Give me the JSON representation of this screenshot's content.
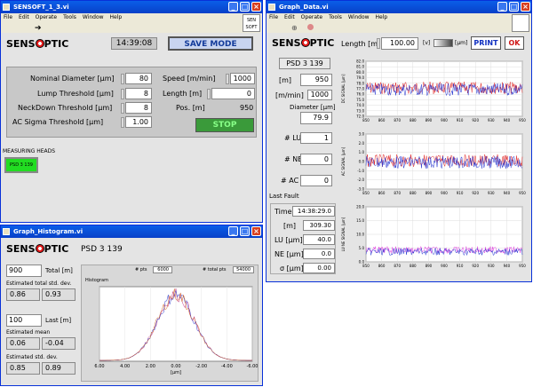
{
  "win1": {
    "title": "SENSOFT_1_3.vi",
    "menu": [
      "File",
      "Edit",
      "Operate",
      "Tools",
      "Window",
      "Help"
    ],
    "logo": "SENSOPTIC",
    "clock": "14:39:08",
    "save_mode": "SAVE MODE",
    "params": [
      {
        "label": "Nominal Diameter [µm]",
        "value": "80"
      },
      {
        "label": "Lump Threshold [µm]",
        "value": "8"
      },
      {
        "label": "NeckDown Threshold [µm]",
        "value": "8"
      },
      {
        "label": "AC Sigma Threshold [µm]",
        "value": "1.00"
      }
    ],
    "speed_label": "Speed [m/min]",
    "speed": "1000",
    "length_label": "Length [m]",
    "length": "0",
    "pos_label": "Pos. [m]",
    "pos": "950",
    "stop": "STOP",
    "heads_label": "MEASURING HEADS",
    "head": "PSD 3 139",
    "corner_icon": "SEN SOFT"
  },
  "win2": {
    "title": "Graph_Data.vi",
    "menu": [
      "File",
      "Edit",
      "Operate",
      "Tools",
      "Window",
      "Help"
    ],
    "logo": "SENSOPTIC",
    "length_label": "Length [m]",
    "length": "100.00",
    "unit_v": "[v]",
    "unit_um": "[µm]",
    "print": "PRINT",
    "ok": "OK",
    "head": "PSD 3 139",
    "m_label": "[m]",
    "m_val": "950",
    "mmin_label": "[m/min]",
    "mmin_val": "1000",
    "diam_label": "Diameter [µm]",
    "diam_val": "79.9",
    "lu_label": "# LU",
    "lu_val": "1",
    "ne_label": "# NE",
    "ne_val": "0",
    "ac_label": "# AC σ",
    "ac_val": "0",
    "last_fault": "Last Fault",
    "fault": [
      {
        "label": "Time",
        "value": "14:38:29.0"
      },
      {
        "label": "[m]",
        "value": "309.30"
      },
      {
        "label": "LU [µm]",
        "value": "40.0"
      },
      {
        "label": "NE [µm]",
        "value": "0.0"
      },
      {
        "label": "σ [µm]",
        "value": "0.00"
      }
    ],
    "graphs": [
      {
        "ylabel": "DC SIGNAL [µm]",
        "yticks": [
          "82.0",
          "81.0",
          "80.0",
          "79.0",
          "78.0",
          "77.0",
          "76.0",
          "75.0",
          "74.0",
          "73.0",
          "72.0"
        ]
      },
      {
        "ylabel": "AC SIGNAL [µm]",
        "yticks": [
          "3.0",
          "2.0",
          "1.0",
          "0.0",
          "-1.0",
          "-2.0",
          "-3.0"
        ]
      },
      {
        "ylabel": "LU NE SIGNAL [µm]",
        "yticks": [
          "20.0",
          "15.0",
          "10.0",
          "5.0",
          "0.0"
        ]
      }
    ],
    "xticks": [
      "850",
      "860",
      "870",
      "880",
      "890",
      "900",
      "910",
      "920",
      "930",
      "940",
      "950"
    ]
  },
  "win3": {
    "title": "Graph_Histogram.vi",
    "logo": "SENSOPTIC",
    "head": "PSD 3 139",
    "total_val": "900",
    "total_label": "Total [m]",
    "est_total": "Estimated total std. dev.",
    "et1": "0.86",
    "et2": "0.93",
    "last_val": "100",
    "last_label": "Last [m]",
    "est_mean": "Estimated mean",
    "em1": "0.06",
    "em2": "-0.04",
    "est_std": "Estimated std. dev.",
    "es1": "0.85",
    "es2": "0.89",
    "pts_label": "# pts",
    "pts": "6000",
    "tot_pts_label": "# total pts",
    "tot_pts": "54000",
    "hist_label": "Histogram",
    "xlabel": "[µm]",
    "xticks": [
      "6.00",
      "4.00",
      "2.00",
      "0.00",
      "-2.00",
      "-4.00",
      "-6.00"
    ]
  },
  "colors": {
    "titlebar": "#0a5ee8",
    "stop": "#3a9a3a",
    "head": "#22dd22",
    "signal_red": "#e02020",
    "signal_blue": "#2030d0"
  }
}
